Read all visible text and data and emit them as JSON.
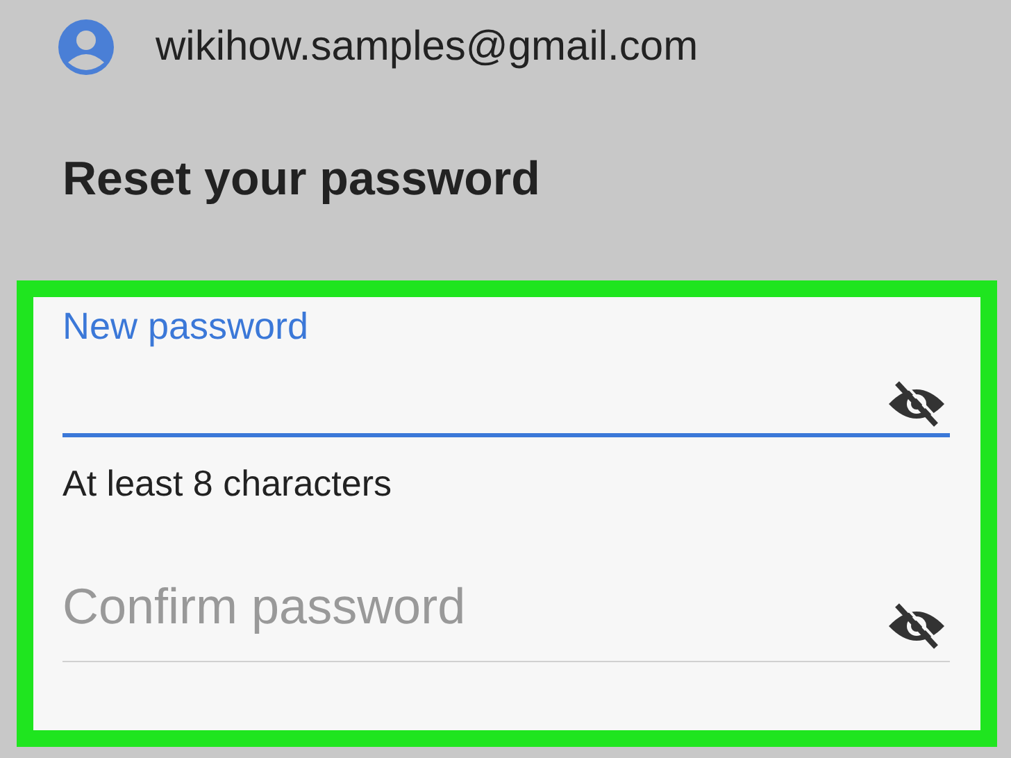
{
  "account": {
    "email": "wikihow.samples@gmail.com"
  },
  "heading": "Reset your password",
  "fields": [
    {
      "label": "New password",
      "focused": true,
      "password_visible": false,
      "helper": "At least 8 characters"
    },
    {
      "label": "Confirm password",
      "focused": false,
      "password_visible": false
    }
  ]
}
